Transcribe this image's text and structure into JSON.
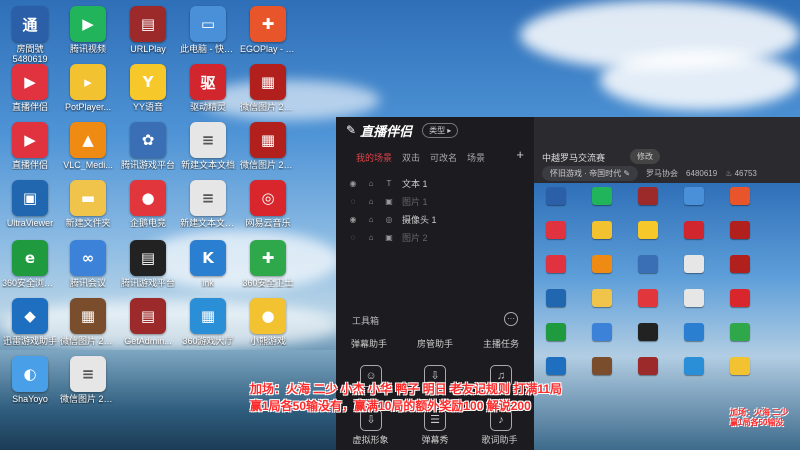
{
  "desktop": {
    "icons": [
      {
        "label": "房間號",
        "sub": "5480619",
        "glyph": "通",
        "color": "#2b5fa8"
      },
      {
        "label": "腾讯视频",
        "glyph": "▶",
        "color": "#21b45a"
      },
      {
        "label": "URLPlay",
        "glyph": "▤",
        "color": "#9c2a2a"
      },
      {
        "label": "此电脑 - 快捷方式",
        "glyph": "▭",
        "color": "#4a90d9"
      },
      {
        "label": "EGOPlay - 快捷方式",
        "glyph": "✚",
        "color": "#e8552a"
      },
      {
        "label": "直播伴侣",
        "glyph": "▶",
        "color": "#e0333f"
      },
      {
        "label": "PotPlayer...",
        "glyph": "▸",
        "color": "#f2c230"
      },
      {
        "label": "YY语音",
        "glyph": "Y",
        "color": "#f7c82a"
      },
      {
        "label": "驱动精灵",
        "glyph": "驱",
        "color": "#d1262e"
      },
      {
        "label": "微信图片 2021100...",
        "glyph": "▦",
        "color": "#b1201c"
      },
      {
        "label": "直播伴侣",
        "glyph": "▶",
        "color": "#e0333f"
      },
      {
        "label": "VLC_Medi...",
        "glyph": "▲",
        "color": "#ef8a12"
      },
      {
        "label": "腾讯游戏平台",
        "glyph": "✿",
        "color": "#3a6fb5"
      },
      {
        "label": "新建文本文档",
        "glyph": "≡",
        "color": "#e6e6e6"
      },
      {
        "label": "微信图片 2021100...",
        "glyph": "▦",
        "color": "#b1201c"
      },
      {
        "label": "UltraViewer",
        "glyph": "▣",
        "color": "#2067b0"
      },
      {
        "label": "新建文件夹",
        "glyph": "▬",
        "color": "#f0c44b"
      },
      {
        "label": "企鹅电竞",
        "glyph": "●",
        "color": "#e2363d"
      },
      {
        "label": "新建文本文档 (2)",
        "glyph": "≡",
        "color": "#e6e6e6"
      },
      {
        "label": "网易云音乐",
        "glyph": "◎",
        "color": "#d8262c"
      },
      {
        "label": "360安全浏览器",
        "glyph": "e",
        "color": "#1f9a3e"
      },
      {
        "label": "腾讯会议",
        "glyph": "∞",
        "color": "#3b82d8"
      },
      {
        "label": "腾讯游戏平台",
        "glyph": "▤",
        "color": "#222222"
      },
      {
        "label": "lnk",
        "glyph": "K",
        "color": "#2a7fd1"
      },
      {
        "label": "360安全卫士",
        "glyph": "✚",
        "color": "#2fa84b"
      },
      {
        "label": "迅雷游戏助手",
        "glyph": "◆",
        "color": "#1e6fbf"
      },
      {
        "label": "微信图片 2021080...",
        "glyph": "▦",
        "color": "#7a4d2c"
      },
      {
        "label": "GetAdmin...",
        "glyph": "▤",
        "color": "#9c2a2a"
      },
      {
        "label": "360游戏大厅",
        "glyph": "▦",
        "color": "#2a8fd6"
      },
      {
        "label": "小熊游戏",
        "glyph": "●",
        "color": "#f2c230"
      },
      {
        "label": "ShaYoyo",
        "glyph": "◐",
        "color": "#4aa0e8"
      },
      {
        "label": "微信图片 2021082...",
        "glyph": "≡",
        "color": "#e6e6e6"
      }
    ]
  },
  "app": {
    "logo": "直播伴侣",
    "type_label": "类型",
    "tabs": [
      "我的场景",
      "双击",
      "可改名",
      "场景"
    ],
    "plus_label": "+",
    "scenes": [
      {
        "label": "文本 1",
        "dim": false
      },
      {
        "label": "图片 1",
        "dim": true
      },
      {
        "label": "摄像头 1",
        "dim": false
      },
      {
        "label": "图片 2",
        "dim": true
      }
    ],
    "tools_title": "工具箱",
    "more_label": "···",
    "tools_row1": [
      "弹幕助手",
      "房管助手",
      "主播任务"
    ],
    "tools_row2": [
      "虚拟形象",
      "弹幕秀",
      "歌词助手"
    ]
  },
  "preview": {
    "title": "中越罗马交流赛",
    "edit_label": "修改",
    "category": "怀旧游戏 · 帝国时代",
    "guild": "罗马协会",
    "room_id": "6480619",
    "fans": "46753"
  },
  "banner": {
    "line1": "加场：火海 二少 小杰 小华 鸭子 明日 老友记规则 打满11局",
    "line2": "赢1局各50输没有，赢满10局的额外奖励100 解说200",
    "mini1": "加场：火海 二少",
    "mini2": "赢1局各50输没"
  }
}
